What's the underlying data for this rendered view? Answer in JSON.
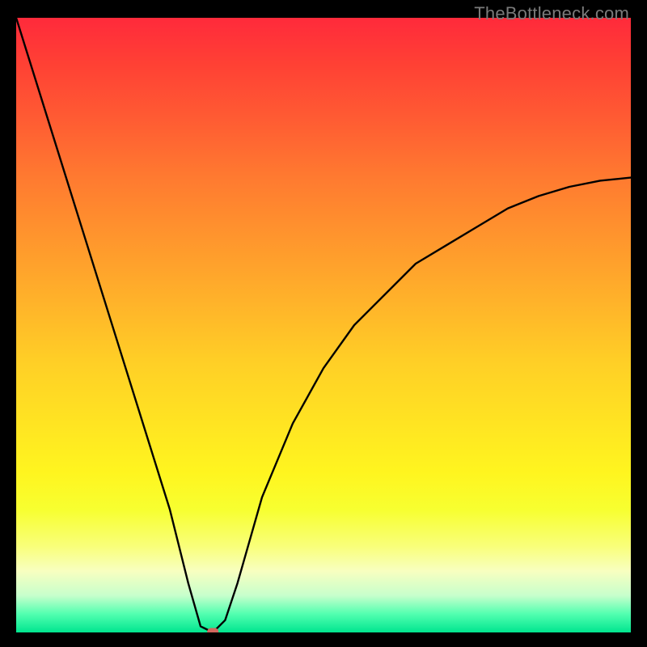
{
  "watermark": "TheBottleneck.com",
  "chart_data": {
    "type": "line",
    "title": "",
    "xlabel": "",
    "ylabel": "",
    "xlim": [
      0,
      100
    ],
    "ylim": [
      0,
      100
    ],
    "grid": false,
    "legend": false,
    "background": "gradient-red-yellow-green",
    "series": [
      {
        "name": "bottleneck-curve",
        "x": [
          0,
          5,
          10,
          15,
          20,
          25,
          28,
          30,
          32,
          34,
          36,
          40,
          45,
          50,
          55,
          60,
          65,
          70,
          75,
          80,
          85,
          90,
          95,
          100
        ],
        "y": [
          100,
          84,
          68,
          52,
          36,
          20,
          8,
          1,
          0,
          2,
          8,
          22,
          34,
          43,
          50,
          55,
          60,
          63,
          66,
          69,
          71,
          72.5,
          73.5,
          74
        ]
      }
    ],
    "marker": {
      "x": 32,
      "y": 0,
      "shape": "rounded-dot",
      "color": "#d1675e"
    }
  }
}
